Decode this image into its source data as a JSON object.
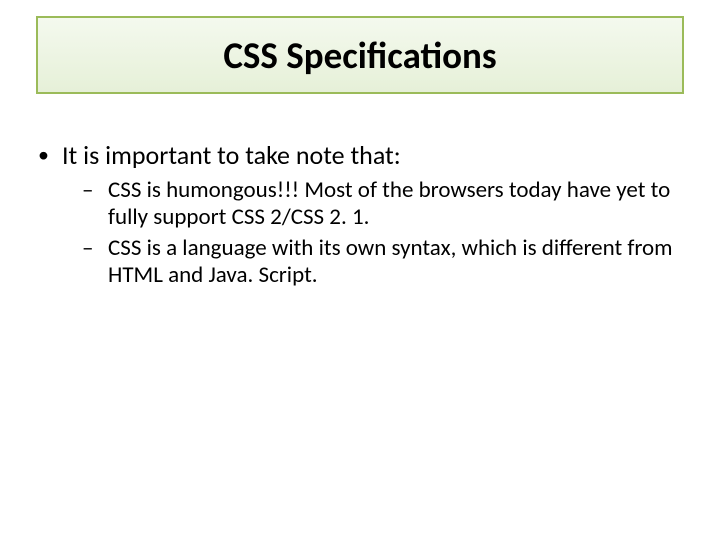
{
  "title": "CSS Specifications",
  "body": {
    "lead": "It is important to take note that:",
    "points": [
      "CSS is humongous!!! Most of the browsers today have yet to fully support CSS 2/CSS 2. 1.",
      "CSS is a language with its own syntax, which is different from HTML and Java. Script."
    ]
  }
}
